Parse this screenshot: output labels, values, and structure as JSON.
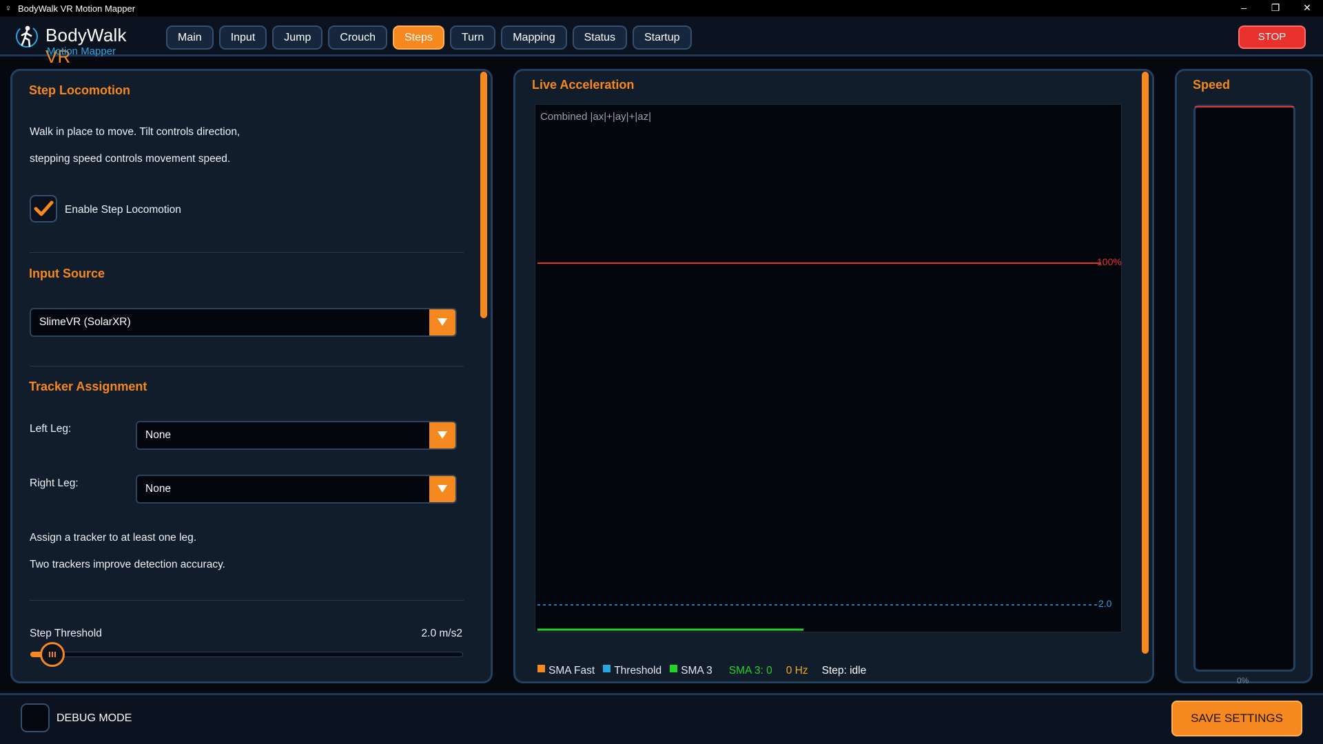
{
  "window": {
    "title": "BodyWalk VR Motion Mapper",
    "controls": [
      "–",
      "❐",
      "✕"
    ]
  },
  "brand": {
    "name": "BodyWalk",
    "name_accent": "VR",
    "subtitle": "Motion Mapper"
  },
  "tabs": [
    {
      "label": "Main"
    },
    {
      "label": "Input"
    },
    {
      "label": "Jump"
    },
    {
      "label": "Crouch"
    },
    {
      "label": "Steps",
      "active": true
    },
    {
      "label": "Turn"
    },
    {
      "label": "Mapping"
    },
    {
      "label": "Status"
    },
    {
      "label": "Startup"
    }
  ],
  "stop_label": "STOP",
  "step_locomotion": {
    "title": "Step Locomotion",
    "desc_line1": "Walk in place to move. Tilt controls direction,",
    "desc_line2": "stepping speed controls movement speed.",
    "enable_label": "Enable Step Locomotion",
    "enabled": true
  },
  "input_source": {
    "title": "Input Source",
    "selected": "SlimeVR (SolarXR)"
  },
  "tracker_assignment": {
    "title": "Tracker Assignment",
    "left_leg_label": "Left Leg:",
    "left_leg_value": "None",
    "right_leg_label": "Right Leg:",
    "right_leg_value": "None",
    "hint_line1": "Assign a tracker to at least one leg.",
    "hint_line2": "Two trackers improve detection accuracy."
  },
  "step_threshold": {
    "label": "Step Threshold",
    "value_text": "2.0 m/s2",
    "value": 2.0
  },
  "live_acceleration": {
    "title": "Live Acceleration",
    "graph_label": "Combined |ax|+|ay|+|az|",
    "max_line_label": "100%",
    "threshold_line_label": "2.0",
    "legend": {
      "sma_fast": "SMA Fast",
      "threshold": "Threshold",
      "sma3": "SMA 3",
      "sma3_value": "SMA 3: 0",
      "hz": "0 Hz",
      "step_state": "Step: idle"
    }
  },
  "speed": {
    "title": "Speed",
    "min_label": "0%",
    "level": 0
  },
  "footer": {
    "debug_label": "DEBUG MODE",
    "save_label": "SAVE SETTINGS"
  },
  "colors": {
    "accent": "#f5881f",
    "stop": "#e8302c",
    "threshold": "#28a6e2",
    "sma3": "#22d32a",
    "panel_border": "#23415f"
  }
}
